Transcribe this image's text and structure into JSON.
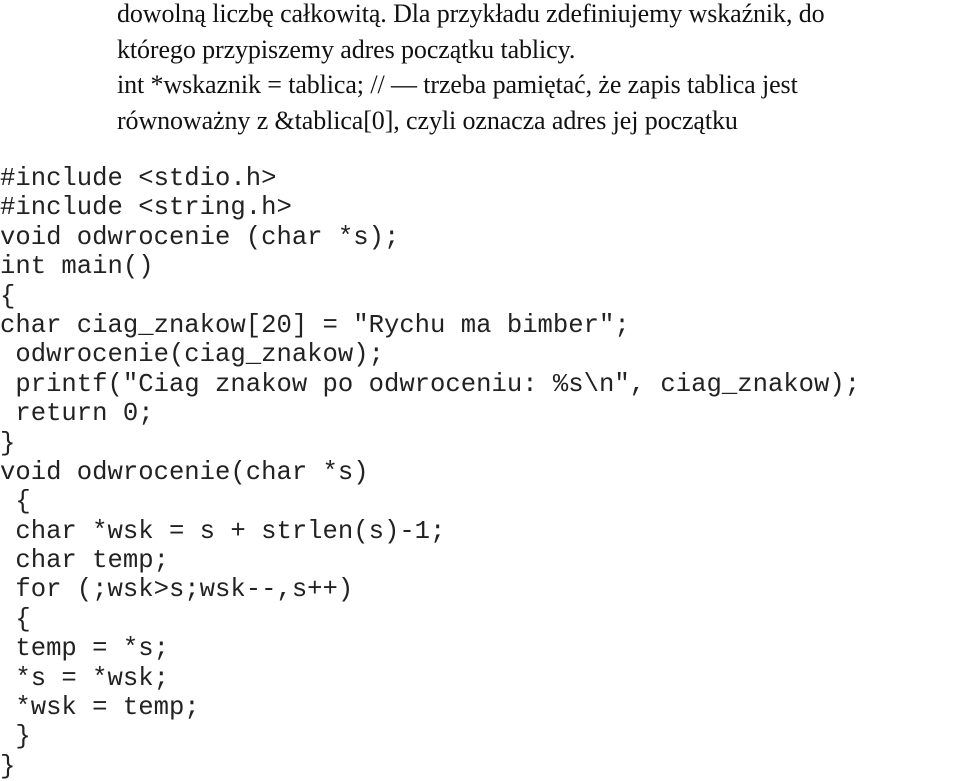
{
  "prose": {
    "lines": [
      "dowolną liczbę całkowitą. Dla przykładu zdefiniujemy wskaźnik, do",
      "którego przypiszemy adres początku tablicy.",
      "int *wskaznik = tablica; // — trzeba pamiętać, że zapis tablica jest",
      "równoważny z &tablica[0], czyli oznacza adres jej początku"
    ]
  },
  "code": {
    "lines": [
      "#include <stdio.h>",
      "#include <string.h>",
      "void odwrocenie (char *s);",
      "int main()",
      "{",
      "char ciag_znakow[20] = \"Rychu ma bimber\";",
      " odwrocenie(ciag_znakow);",
      " printf(\"Ciag znakow po odwroceniu: %s\\n\", ciag_znakow);",
      " return 0;",
      "}",
      "void odwrocenie(char *s)",
      " {",
      " char *wsk = s + strlen(s)-1;",
      " char temp;",
      " for (;wsk>s;wsk--,s++)",
      " {",
      " temp = *s;",
      " *s = *wsk;",
      " *wsk = temp;",
      " }",
      "}"
    ]
  }
}
